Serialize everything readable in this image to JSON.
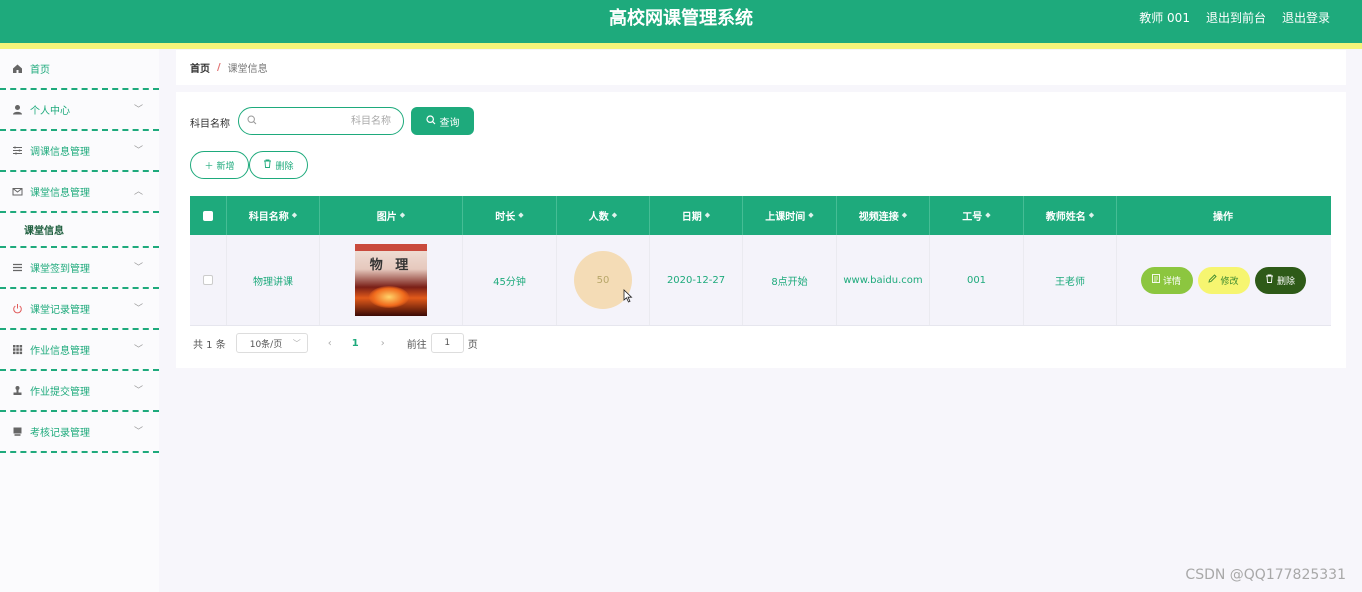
{
  "header": {
    "title": "高校网课管理系统",
    "user": "教师 001",
    "to_front": "退出到前台",
    "logout": "退出登录"
  },
  "sidebar": {
    "items": [
      {
        "label": "首页",
        "icon": "home-icon"
      },
      {
        "label": "个人中心",
        "icon": "user-icon"
      },
      {
        "label": "调课信息管理",
        "icon": "sliders-icon"
      },
      {
        "label": "课堂信息管理",
        "icon": "envelope-icon"
      },
      {
        "label": "课堂签到管理",
        "icon": "list-icon"
      },
      {
        "label": "课堂记录管理",
        "icon": "power-icon"
      },
      {
        "label": "作业信息管理",
        "icon": "grid-icon"
      },
      {
        "label": "作业提交管理",
        "icon": "stamp-icon"
      },
      {
        "label": "考核记录管理",
        "icon": "folder-icon"
      }
    ],
    "submenu": "课堂信息"
  },
  "breadcrumb": {
    "home": "首页",
    "sep": "/",
    "current": "课堂信息"
  },
  "search": {
    "label": "科目名称",
    "placeholder": "科目名称",
    "query_label": "查询"
  },
  "actions": {
    "add_label": "新增",
    "delete_label": "删除"
  },
  "table": {
    "headers": [
      "科目名称",
      "图片",
      "时长",
      "人数",
      "日期",
      "上课时间",
      "视频连接",
      "工号",
      "教师姓名",
      "操作"
    ],
    "rows": [
      {
        "subject": "物理讲课",
        "image_title": "物 理",
        "duration": "45分钟",
        "count": "50",
        "date": "2020-12-27",
        "time": "8点开始",
        "video": "www.baidu.com",
        "job_no": "001",
        "teacher": "王老师",
        "ops": {
          "detail": "详情",
          "edit": "修改",
          "delete": "删除"
        }
      }
    ]
  },
  "pagination": {
    "total": "共 1 条",
    "page_size": "10条/页",
    "current_page": "1",
    "goto": "前往",
    "goto_value": "1",
    "unit": "页"
  },
  "watermark": "CSDN @QQ177825331",
  "colors": {
    "primary": "#1eaa7c",
    "accent_yellow": "#f4f47a",
    "detail": "#8cc63f",
    "edit": "#f6f570",
    "delete": "#2e5a18"
  }
}
